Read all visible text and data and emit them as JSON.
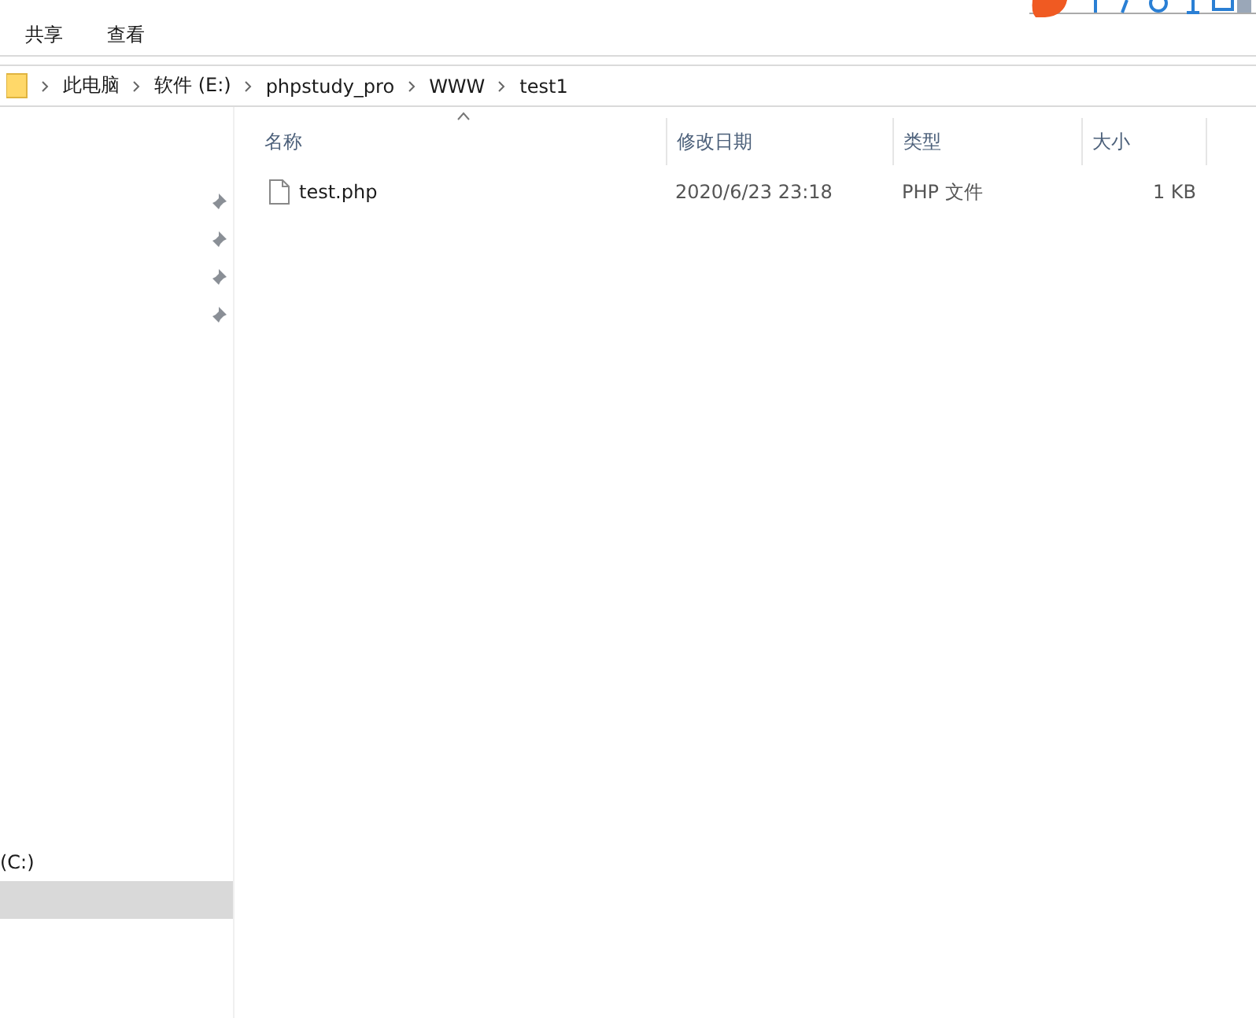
{
  "ribbon": {
    "tabs": [
      {
        "label": "共享",
        "selected": false
      },
      {
        "label": "查看",
        "selected": false
      }
    ]
  },
  "address_bar": {
    "path": [
      "此电脑",
      "软件 (E:)",
      "phpstudy_pro",
      "WWW",
      "test1"
    ]
  },
  "nav_pane": {
    "pinned_count_items": [
      {
        "pinned": true
      },
      {
        "pinned": true
      },
      {
        "pinned": true
      },
      {
        "pinned": true
      }
    ],
    "items": [
      {
        "label": "(C:)",
        "selected": false
      },
      {
        "selected": true
      }
    ]
  },
  "file_list": {
    "columns": [
      {
        "label": "名称",
        "sorted": true
      },
      {
        "label": "修改日期",
        "sorted": false
      },
      {
        "label": "类型",
        "sorted": false
      },
      {
        "label": "大小",
        "sorted": false
      }
    ],
    "rows": [
      {
        "name": "test.php",
        "modified": "2020/6/23 23:18",
        "type": "PHP 文件",
        "size": "1 KB"
      }
    ]
  }
}
